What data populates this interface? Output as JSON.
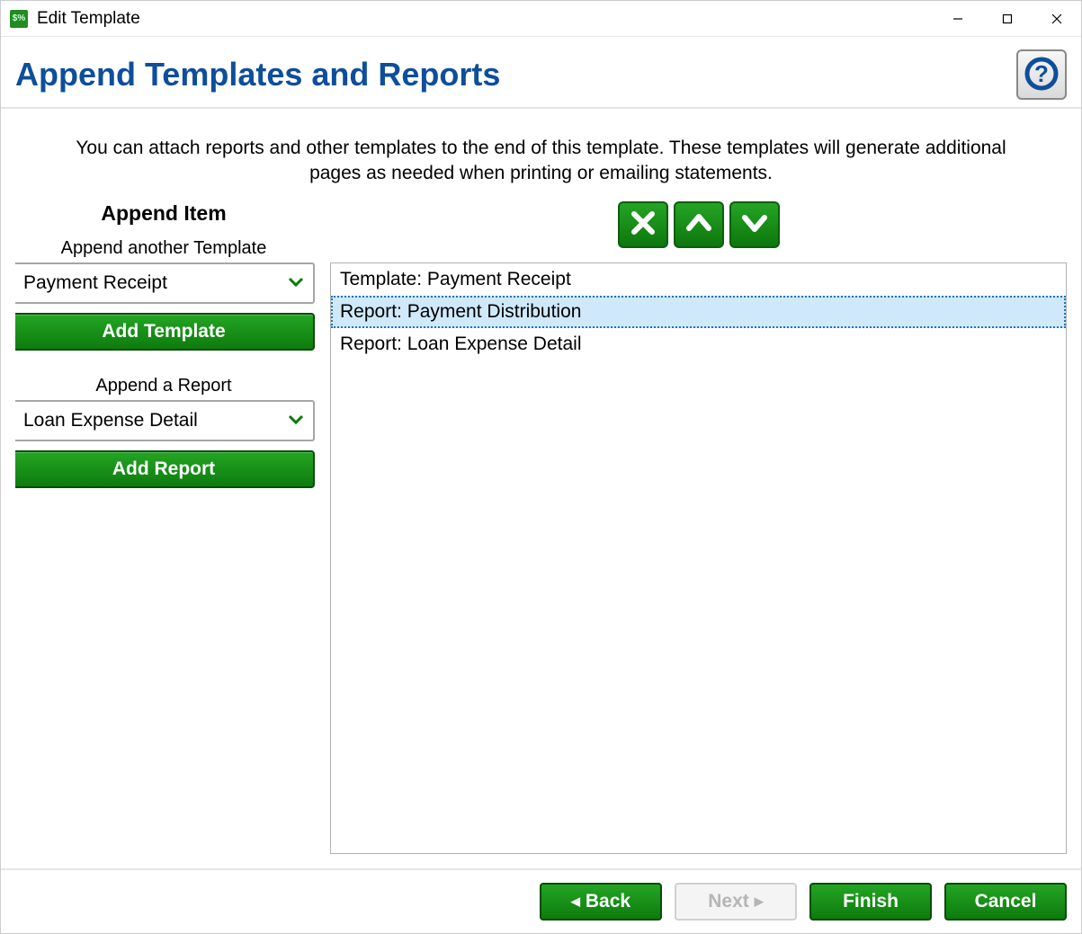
{
  "window": {
    "title": "Edit Template"
  },
  "header": {
    "title": "Append Templates and Reports"
  },
  "description": "You can attach reports and other templates to the end of this template.  These templates will generate additional pages as needed when printing or emailing statements.",
  "left": {
    "section_title": "Append Item",
    "template_label": "Append another Template",
    "template_value": "Payment Receipt",
    "add_template_label": "Add Template",
    "report_label": "Append a Report",
    "report_value": "Loan Expense Detail",
    "add_report_label": "Add Report"
  },
  "list": {
    "items": [
      {
        "label": "Template: Payment Receipt",
        "selected": false
      },
      {
        "label": "Report: Payment Distribution",
        "selected": true
      },
      {
        "label": "Report: Loan Expense Detail",
        "selected": false
      }
    ]
  },
  "footer": {
    "back_label": "Back",
    "next_label": "Next",
    "finish_label": "Finish",
    "cancel_label": "Cancel"
  }
}
